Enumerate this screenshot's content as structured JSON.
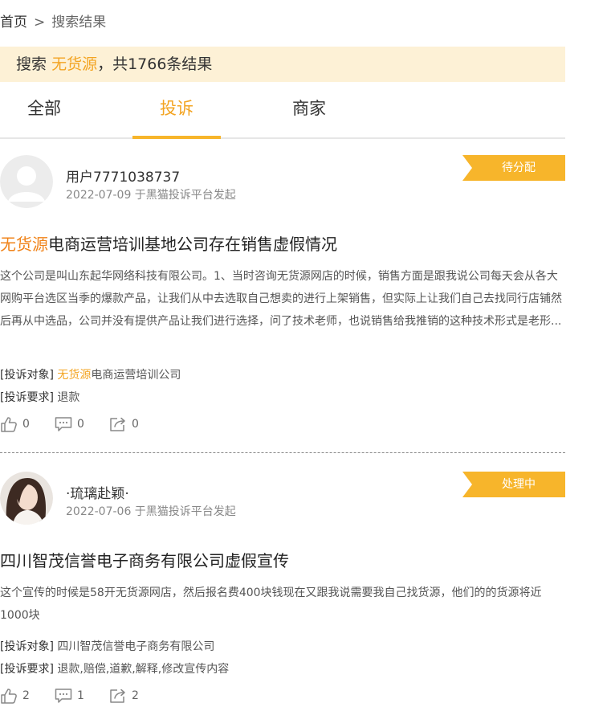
{
  "breadcrumb": {
    "home": "首页",
    "separator": ">",
    "current": "搜索结果"
  },
  "summary": {
    "prefix": "搜索",
    "keyword": "无货源",
    "suffix": "，共1766条结果"
  },
  "tabs": [
    {
      "label": "全部",
      "active": false
    },
    {
      "label": "投诉",
      "active": true
    },
    {
      "label": "商家",
      "active": false
    }
  ],
  "complaints": [
    {
      "user": "用户7771038737",
      "meta": "2022-07-09 于黑猫投诉平台发起",
      "status": "待分配",
      "title_keyword": "无货源",
      "title_rest": "电商运营培训基地公司存在销售虚假情况",
      "description": "这个公司是叫山东起华网络科技有限公司。1、当时咨询无货源网店的时候，销售方面是跟我说公司每天会从各大网购平台选区当季的爆款产品，让我们从中去选取自己想卖的进行上架销售，但实际上让我们自己去找同行店铺然后再从中选品，公司并没有提供产品让我们进行选择，问了技术老师，也说销售给我推销的这种技术形式是老形...",
      "target_label": "[投诉对象]",
      "target_keyword": "无货源",
      "target_rest": "电商运营培训公司",
      "demand_label": "[投诉要求]",
      "demand": "退款",
      "likes": "0",
      "comments": "0",
      "shares": "0"
    },
    {
      "user": "·琉璃赴颖·",
      "meta": "2022-07-06 于黑猫投诉平台发起",
      "status": "处理中",
      "title_keyword": "",
      "title_rest": "四川智茂信誉电子商务有限公司虚假宣传",
      "description": "这个宣传的时候是58开无货源网店，然后报名费400块钱现在又跟我说需要我自己找货源，他们的的货源将近1000块",
      "target_label": "[投诉对象]",
      "target_keyword": "",
      "target_rest": "四川智茂信誉电子商务有限公司",
      "demand_label": "[投诉要求]",
      "demand": "退款,赔偿,道歉,解释,修改宣传内容",
      "likes": "2",
      "comments": "1",
      "shares": "2"
    }
  ],
  "colors": {
    "accent": "#f7b52b",
    "keyword": "#f3a422",
    "summary_bg": "#fdf1d6"
  }
}
